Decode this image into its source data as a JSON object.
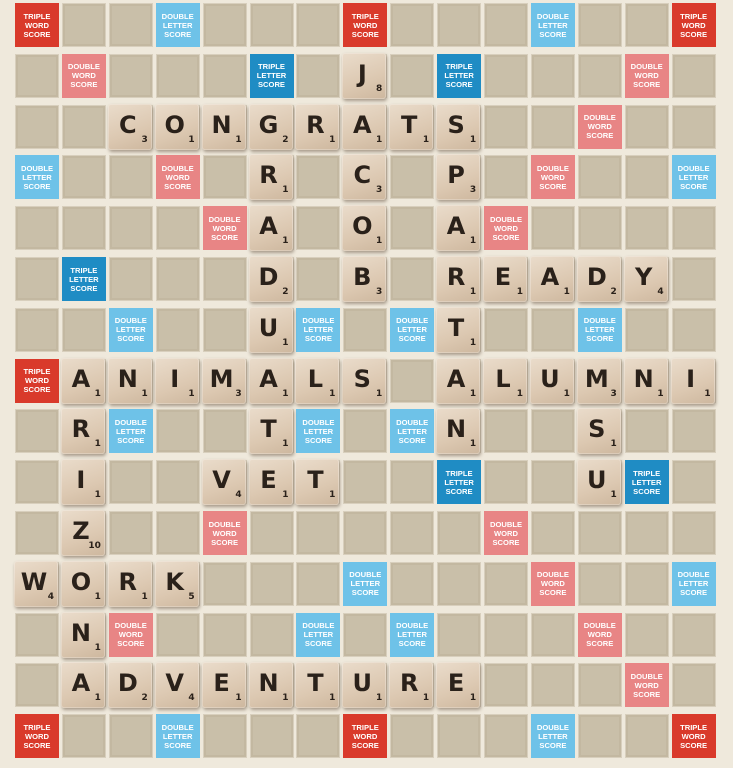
{
  "labels": {
    "TW": [
      "TRIPLE",
      "WORD",
      "SCORE"
    ],
    "DW": [
      "DOUBLE",
      "WORD",
      "SCORE"
    ],
    "TL": [
      "TRIPLE",
      "LETTER",
      "SCORE"
    ],
    "DL": [
      "DOUBLE",
      "LETTER",
      "SCORE"
    ]
  },
  "colors": {
    "TW": "#d93a2b",
    "DW": "#e88585",
    "TL": "#1f8cc4",
    "DL": "#6ec2e8"
  },
  "premiums": [
    [
      "TW",
      0,
      0
    ],
    [
      "DL",
      0,
      3
    ],
    [
      "TW",
      0,
      7
    ],
    [
      "DL",
      0,
      11
    ],
    [
      "TW",
      0,
      14
    ],
    [
      "DW",
      1,
      1
    ],
    [
      "TL",
      1,
      5
    ],
    [
      "TL",
      1,
      9
    ],
    [
      "DW",
      1,
      13
    ],
    [
      "DW",
      2,
      12
    ],
    [
      "DL",
      3,
      0
    ],
    [
      "DW",
      3,
      3
    ],
    [
      "DW",
      3,
      11
    ],
    [
      "DL",
      3,
      14
    ],
    [
      "DW",
      4,
      4
    ],
    [
      "DW",
      4,
      10
    ],
    [
      "TL",
      5,
      1
    ],
    [
      "DL",
      6,
      2
    ],
    [
      "DL",
      6,
      6
    ],
    [
      "DL",
      6,
      8
    ],
    [
      "DL",
      6,
      12
    ],
    [
      "TW",
      7,
      0
    ],
    [
      "DL",
      8,
      2
    ],
    [
      "DL",
      8,
      6
    ],
    [
      "DL",
      8,
      8
    ],
    [
      "TL",
      9,
      9
    ],
    [
      "TL",
      9,
      13
    ],
    [
      "DW",
      10,
      4
    ],
    [
      "DW",
      10,
      10
    ],
    [
      "DL",
      11,
      7
    ],
    [
      "DW",
      11,
      11
    ],
    [
      "DL",
      11,
      14
    ],
    [
      "DW",
      12,
      2
    ],
    [
      "DL",
      12,
      6
    ],
    [
      "DL",
      12,
      8
    ],
    [
      "DW",
      12,
      12
    ],
    [
      "DW",
      13,
      13
    ],
    [
      "TW",
      14,
      0
    ],
    [
      "DL",
      14,
      3
    ],
    [
      "TW",
      14,
      7
    ],
    [
      "DL",
      14,
      11
    ],
    [
      "TW",
      14,
      14
    ]
  ],
  "tiles": [
    {
      "letter": "C",
      "points": "3",
      "row": 2,
      "col": 2
    },
    {
      "letter": "O",
      "points": "1",
      "row": 2,
      "col": 3
    },
    {
      "letter": "N",
      "points": "1",
      "row": 2,
      "col": 4
    },
    {
      "letter": "G",
      "points": "2",
      "row": 2,
      "col": 5
    },
    {
      "letter": "R",
      "points": "1",
      "row": 2,
      "col": 6
    },
    {
      "letter": "A",
      "points": "1",
      "row": 2,
      "col": 7
    },
    {
      "letter": "T",
      "points": "1",
      "row": 2,
      "col": 8
    },
    {
      "letter": "S",
      "points": "1",
      "row": 2,
      "col": 9
    },
    {
      "letter": "J",
      "points": "8",
      "row": 1,
      "col": 7
    },
    {
      "letter": "C",
      "points": "3",
      "row": 3,
      "col": 7
    },
    {
      "letter": "O",
      "points": "1",
      "row": 4,
      "col": 7
    },
    {
      "letter": "B",
      "points": "3",
      "row": 5,
      "col": 7
    },
    {
      "letter": "S",
      "points": "1",
      "row": 7,
      "col": 7
    },
    {
      "letter": "R",
      "points": "1",
      "row": 3,
      "col": 5
    },
    {
      "letter": "A",
      "points": "1",
      "row": 4,
      "col": 5
    },
    {
      "letter": "D",
      "points": "2",
      "row": 5,
      "col": 5
    },
    {
      "letter": "U",
      "points": "1",
      "row": 6,
      "col": 5
    },
    {
      "letter": "A",
      "points": "1",
      "row": 7,
      "col": 5
    },
    {
      "letter": "T",
      "points": "1",
      "row": 8,
      "col": 5
    },
    {
      "letter": "E",
      "points": "1",
      "row": 9,
      "col": 5
    },
    {
      "letter": "P",
      "points": "3",
      "row": 3,
      "col": 9
    },
    {
      "letter": "A",
      "points": "1",
      "row": 4,
      "col": 9
    },
    {
      "letter": "R",
      "points": "1",
      "row": 5,
      "col": 9
    },
    {
      "letter": "T",
      "points": "1",
      "row": 6,
      "col": 9
    },
    {
      "letter": "A",
      "points": "1",
      "row": 7,
      "col": 9
    },
    {
      "letter": "N",
      "points": "1",
      "row": 8,
      "col": 9
    },
    {
      "letter": "E",
      "points": "1",
      "row": 5,
      "col": 10
    },
    {
      "letter": "A",
      "points": "1",
      "row": 5,
      "col": 11
    },
    {
      "letter": "D",
      "points": "2",
      "row": 5,
      "col": 12
    },
    {
      "letter": "Y",
      "points": "4",
      "row": 5,
      "col": 13
    },
    {
      "letter": "A",
      "points": "1",
      "row": 7,
      "col": 1
    },
    {
      "letter": "N",
      "points": "1",
      "row": 7,
      "col": 2
    },
    {
      "letter": "I",
      "points": "1",
      "row": 7,
      "col": 3
    },
    {
      "letter": "M",
      "points": "3",
      "row": 7,
      "col": 4
    },
    {
      "letter": "L",
      "points": "1",
      "row": 7,
      "col": 6
    },
    {
      "letter": "L",
      "points": "1",
      "row": 7,
      "col": 10
    },
    {
      "letter": "U",
      "points": "1",
      "row": 7,
      "col": 11
    },
    {
      "letter": "M",
      "points": "3",
      "row": 7,
      "col": 12
    },
    {
      "letter": "N",
      "points": "1",
      "row": 7,
      "col": 13
    },
    {
      "letter": "I",
      "points": "1",
      "row": 7,
      "col": 14
    },
    {
      "letter": "S",
      "points": "1",
      "row": 8,
      "col": 12
    },
    {
      "letter": "U",
      "points": "1",
      "row": 9,
      "col": 12
    },
    {
      "letter": "V",
      "points": "4",
      "row": 9,
      "col": 4
    },
    {
      "letter": "T",
      "points": "1",
      "row": 9,
      "col": 6
    },
    {
      "letter": "R",
      "points": "1",
      "row": 8,
      "col": 1
    },
    {
      "letter": "I",
      "points": "1",
      "row": 9,
      "col": 1
    },
    {
      "letter": "Z",
      "points": "10",
      "row": 10,
      "col": 1
    },
    {
      "letter": "O",
      "points": "1",
      "row": 11,
      "col": 1
    },
    {
      "letter": "N",
      "points": "1",
      "row": 12,
      "col": 1
    },
    {
      "letter": "A",
      "points": "1",
      "row": 13,
      "col": 1
    },
    {
      "letter": "W",
      "points": "4",
      "row": 11,
      "col": 0
    },
    {
      "letter": "R",
      "points": "1",
      "row": 11,
      "col": 2
    },
    {
      "letter": "K",
      "points": "5",
      "row": 11,
      "col": 3
    },
    {
      "letter": "D",
      "points": "2",
      "row": 13,
      "col": 2
    },
    {
      "letter": "V",
      "points": "4",
      "row": 13,
      "col": 3
    },
    {
      "letter": "E",
      "points": "1",
      "row": 13,
      "col": 4
    },
    {
      "letter": "N",
      "points": "1",
      "row": 13,
      "col": 5
    },
    {
      "letter": "T",
      "points": "1",
      "row": 13,
      "col": 6
    },
    {
      "letter": "U",
      "points": "1",
      "row": 13,
      "col": 7
    },
    {
      "letter": "R",
      "points": "1",
      "row": 13,
      "col": 8
    },
    {
      "letter": "E",
      "points": "1",
      "row": 13,
      "col": 9
    }
  ]
}
